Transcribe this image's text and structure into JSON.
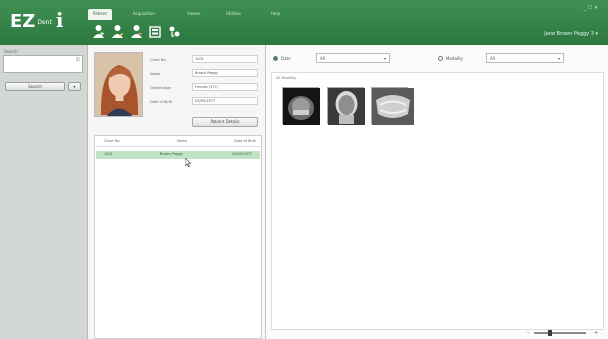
{
  "app": {
    "name": "EZ",
    "subname": "Dent",
    "suffix": "i"
  },
  "header": {
    "tabs": [
      {
        "label": "Patient"
      },
      {
        "label": "Acquisition"
      },
      {
        "label": "Viewer"
      },
      {
        "label": "Utilities"
      },
      {
        "label": "Help"
      }
    ],
    "window_controls": "_ ☐ ✕",
    "user_label": "Jane Brown Peggy 3 ▾"
  },
  "toolbar": {
    "icons": [
      "new-patient-icon",
      "edit-patient-icon",
      "delete-patient-icon",
      "export-icon",
      "merge-icon"
    ]
  },
  "search": {
    "label": "Search",
    "value": "ID",
    "button_label": "Search",
    "dropdown_label": "▾"
  },
  "patient": {
    "fields": [
      {
        "label": "Chart No.",
        "value": "1001"
      },
      {
        "label": "Name",
        "value": "Brown Peggy"
      },
      {
        "label": "Gender/Age",
        "value": "Female (37Y)"
      },
      {
        "label": "Date of Birth",
        "value": "03/05/1977"
      }
    ],
    "details_button": "Patient Details"
  },
  "patient_list": {
    "columns": [
      "Chart No.",
      "Name",
      "Date of Birth"
    ],
    "rows": [
      {
        "chart_no": "1001",
        "name": "Brown Peggy",
        "dob": "03/05/1977"
      }
    ]
  },
  "viewer": {
    "options": [
      {
        "label": "Date",
        "select_value": "All",
        "selected": true
      },
      {
        "label": "Modality",
        "select_value": "All",
        "selected": false
      }
    ],
    "caption": "All Modality",
    "thumbnails": [
      {
        "name": "cbct-3d-thumbnail"
      },
      {
        "name": "ceph-thumbnail"
      },
      {
        "name": "panoramic-thumbnail"
      }
    ]
  },
  "zoom": {
    "minus": "–",
    "plus": "+",
    "level": 0.3
  },
  "colors": {
    "header_green": "#2f7d44",
    "selected_row": "#bfe3c3"
  }
}
